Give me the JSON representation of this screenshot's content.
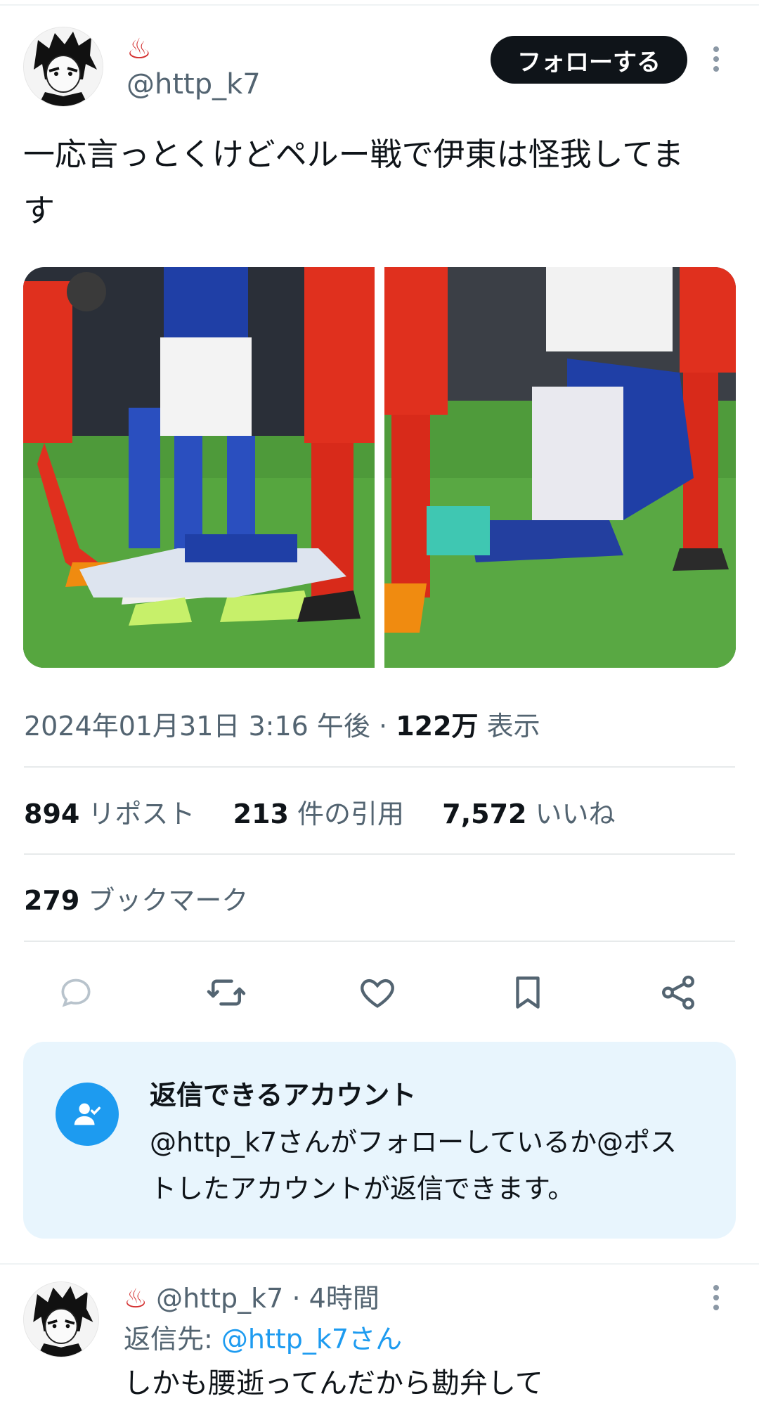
{
  "post": {
    "display_name_icon": "♨",
    "handle": "@http_k7",
    "follow_label": "フォローする",
    "text_line1": "一応言っとくけどペルー戦で伊東は怪我してま",
    "text_line2": "す",
    "timestamp": "2024年01月31日 3:16 午後",
    "separator": "·",
    "views_count": "122万",
    "views_label": "表示"
  },
  "stats": {
    "reposts_count": "894",
    "reposts_label": "リポスト",
    "quotes_count": "213",
    "quotes_label": "件の引用",
    "likes_count": "7,572",
    "likes_label": "いいね",
    "bookmarks_count": "279",
    "bookmarks_label": "ブックマーク"
  },
  "reply_restriction": {
    "title": "返信できるアカウント",
    "line1": "@http_k7さんがフォローしているか@ポス",
    "line2": "トしたアカウントが返信できます。"
  },
  "reply": {
    "display_name_icon": "♨",
    "handle": "@http_k7",
    "separator": "·",
    "time": "4時間",
    "reply_to_label": "返信先:",
    "reply_to_handle": "@http_k7さん",
    "text": "しかも腰逝ってんだから勘弁して"
  },
  "icons": [
    "more-icon",
    "reply-icon",
    "repost-icon",
    "like-icon",
    "bookmark-icon",
    "share-icon",
    "user-check-icon"
  ],
  "colors": {
    "accent": "#1d9bf0",
    "text": "#0f1419",
    "muted": "#536471",
    "display_name": "#d32f2f",
    "reply_box_bg": "#e8f5fd"
  }
}
